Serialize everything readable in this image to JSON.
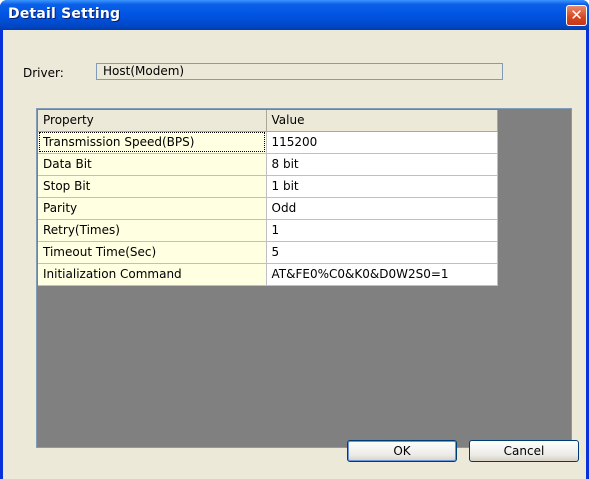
{
  "window": {
    "title": "Detail Setting",
    "close_glyph": "✕"
  },
  "driver": {
    "label": "Driver:",
    "value": "Host(Modem)"
  },
  "grid": {
    "headers": [
      "Property",
      "Value"
    ],
    "rows": [
      {
        "property": "Transmission Speed(BPS)",
        "value": "115200"
      },
      {
        "property": "Data Bit",
        "value": "8 bit"
      },
      {
        "property": "Stop Bit",
        "value": "1 bit"
      },
      {
        "property": "Parity",
        "value": "Odd"
      },
      {
        "property": "Retry(Times)",
        "value": "1"
      },
      {
        "property": "Timeout Time(Sec)",
        "value": "5"
      },
      {
        "property": "Initialization Command",
        "value": "AT&FE0%C0&K0&D0W2S0=1"
      }
    ]
  },
  "buttons": {
    "ok": "OK",
    "cancel": "Cancel"
  },
  "colors": {
    "titlebar": "#0054e3",
    "property_cell": "#ffffe1",
    "grid_background": "#808080",
    "dialog_face": "#ece9d8"
  }
}
